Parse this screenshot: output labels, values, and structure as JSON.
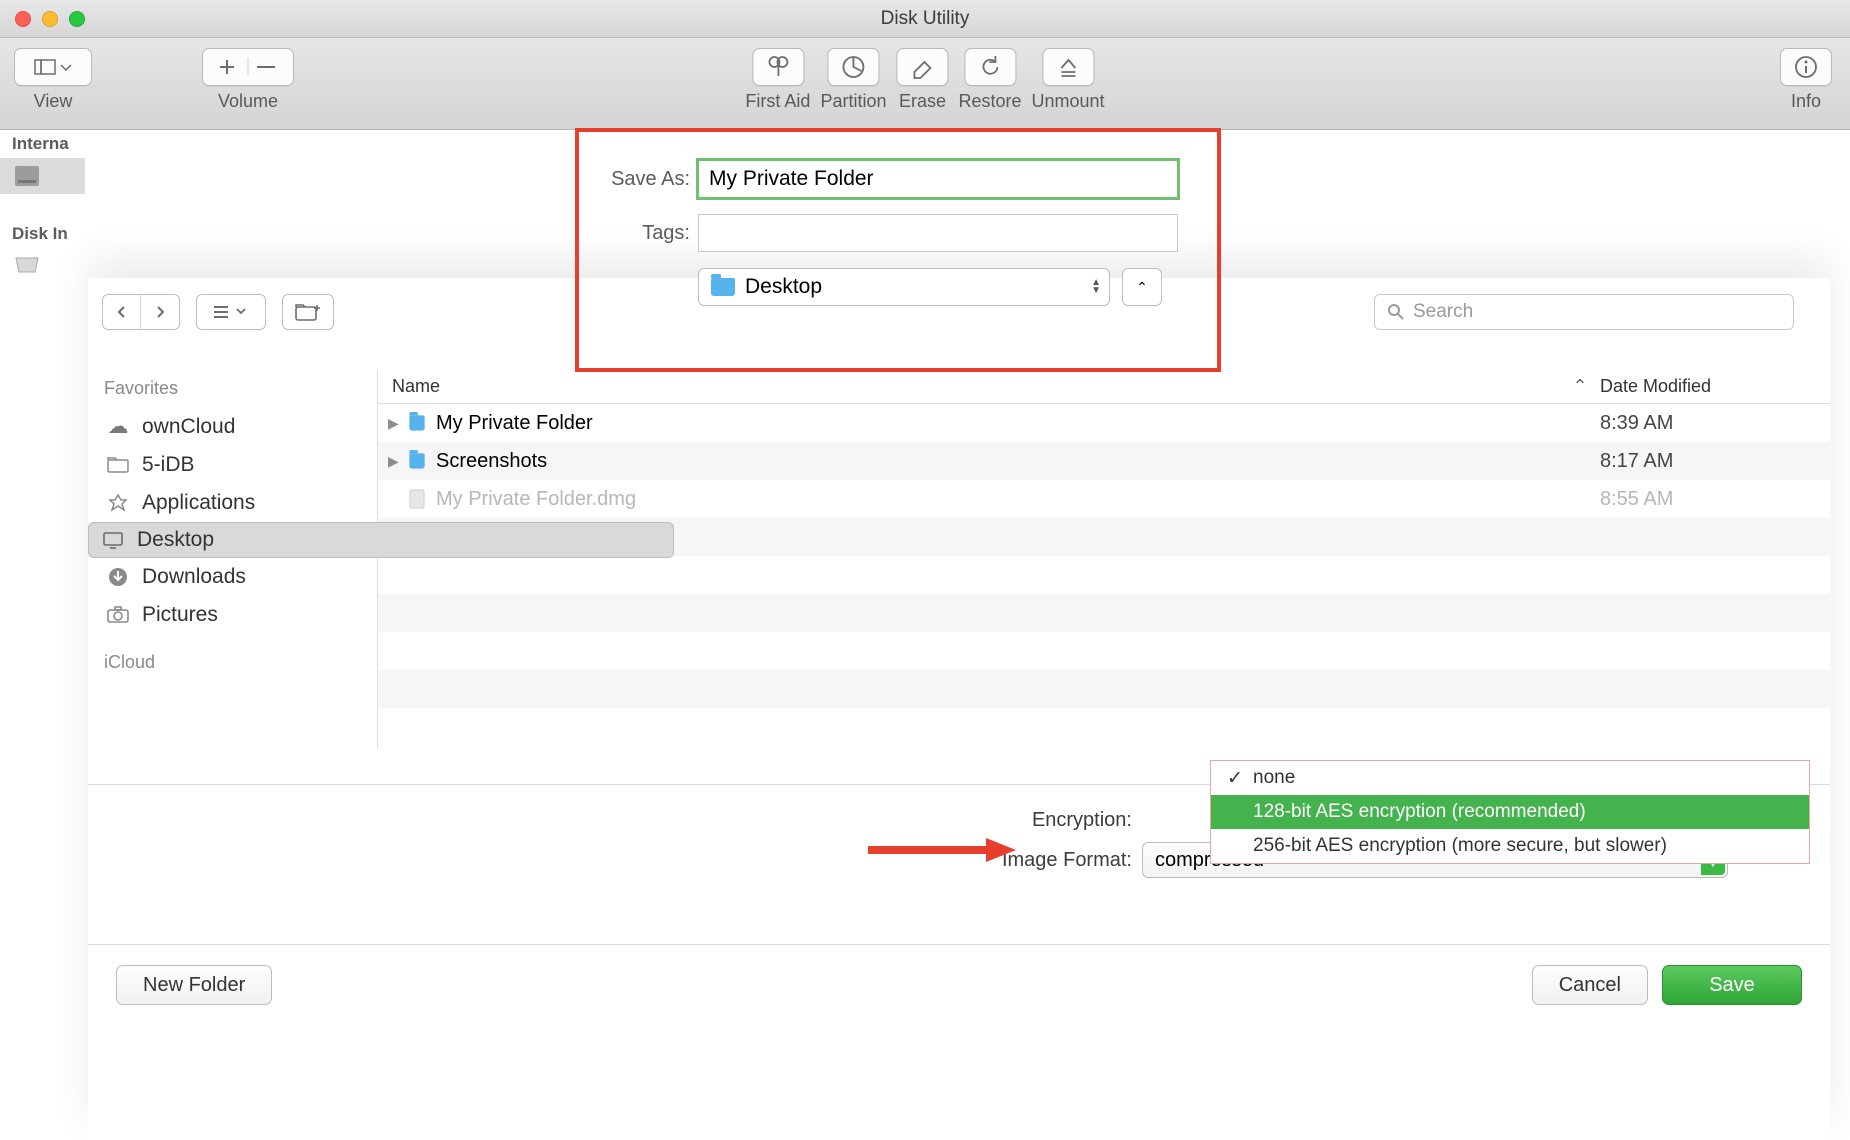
{
  "window": {
    "title": "Disk Utility"
  },
  "toolbar": {
    "view": "View",
    "volume": "Volume",
    "first_aid": "First Aid",
    "partition": "Partition",
    "erase": "Erase",
    "restore": "Restore",
    "unmount": "Unmount",
    "info": "Info"
  },
  "sidebar": {
    "internal": "Interna",
    "disk_images": "Disk In"
  },
  "save_sheet": {
    "save_as_label": "Save As:",
    "save_as_value": "My Private Folder",
    "tags_label": "Tags:",
    "tags_value": "",
    "location": "Desktop",
    "search_placeholder": "Search"
  },
  "favorites": {
    "heading": "Favorites",
    "icloud_heading": "iCloud",
    "items": [
      {
        "label": "ownCloud"
      },
      {
        "label": "5-iDB"
      },
      {
        "label": "Applications"
      },
      {
        "label": "Desktop"
      },
      {
        "label": "Downloads"
      },
      {
        "label": "Pictures"
      }
    ]
  },
  "columns": {
    "name": "Name",
    "date": "Date Modified"
  },
  "files": [
    {
      "name": "My Private Folder",
      "date": "8:39 AM",
      "type": "folder"
    },
    {
      "name": "Screenshots",
      "date": "8:17 AM",
      "type": "folder"
    },
    {
      "name": "My Private Folder.dmg",
      "date": "8:55 AM",
      "type": "file_dim"
    }
  ],
  "form": {
    "encryption_label": "Encryption:",
    "image_format_label": "Image Format:",
    "image_format_value": "compressed"
  },
  "enc_menu": {
    "none": "none",
    "aes128": "128-bit AES encryption (recommended)",
    "aes256": "256-bit AES encryption (more secure, but slower)"
  },
  "buttons": {
    "new_folder": "New Folder",
    "cancel": "Cancel",
    "save": "Save"
  }
}
